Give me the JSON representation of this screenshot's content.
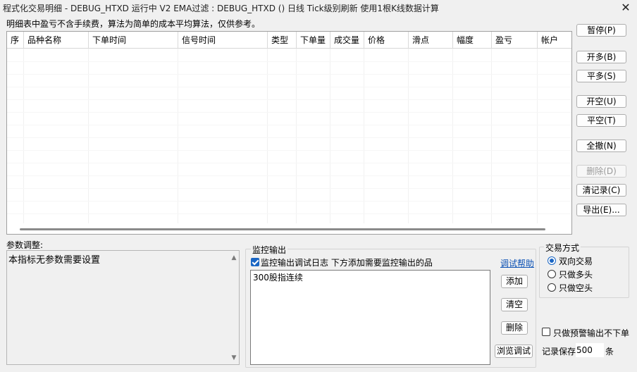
{
  "window": {
    "title": "程式化交易明细 - DEBUG_HTXD 运行中  V2 EMA过滤 : DEBUG_HTXD () 日线 Tick级别刷新 使用1根K线数据计算",
    "close_icon": "close-icon"
  },
  "note": "明细表中盈亏不含手续费，算法为简单的成本平均算法，仅供参考。",
  "table": {
    "columns": [
      "序",
      "品种名称",
      "下单时间",
      "信号时间",
      "类型",
      "下单量",
      "成交量",
      "价格",
      "滑点",
      "幅度",
      "盈亏",
      "帐户"
    ]
  },
  "buttons": {
    "pause": "暂停(P)",
    "open_long": "开多(B)",
    "close_long": "平多(S)",
    "open_short": "开空(U)",
    "close_short": "平空(T)",
    "cancel_all": "全撤(N)",
    "delete": "删除(D)",
    "clear_log": "清记录(C)",
    "export": "导出(E)..."
  },
  "params": {
    "label": "参数调整:",
    "text": "本指标无参数需要设置"
  },
  "monitor": {
    "title": "监控输出",
    "checkbox_label": "监控输出调试日志 下方添加需要监控输出的品",
    "checkbox_checked": true,
    "help_link": "调试帮助",
    "items": [
      "300股指连续"
    ],
    "add": "添加",
    "clear": "清空",
    "remove": "删除",
    "browse": "浏览调试"
  },
  "trade_mode": {
    "title": "交易方式",
    "options": [
      "双向交易",
      "只做多头",
      "只做空头"
    ],
    "selected": "双向交易"
  },
  "alert_only": {
    "label": "只做预警输出不下单",
    "checked": false
  },
  "keep": {
    "label": "记录保存",
    "value": "500",
    "unit": "条"
  },
  "colors": {
    "accent": "#1a66c4",
    "link": "#0a50b4",
    "window_bg": "#f0f0f0"
  }
}
